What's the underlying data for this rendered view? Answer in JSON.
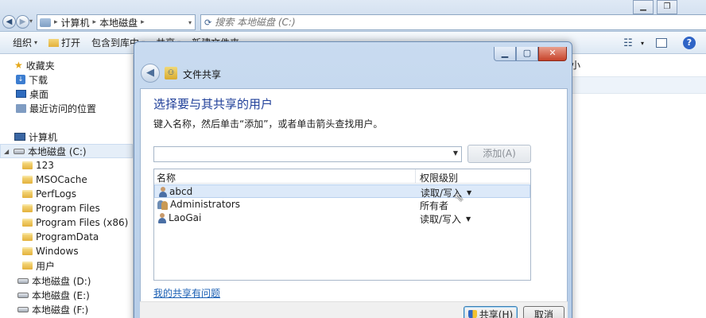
{
  "address": {
    "segments": [
      "计算机",
      "本地磁盘"
    ]
  },
  "search": {
    "placeholder": "搜索 本地磁盘 (C:)"
  },
  "toolbar": {
    "organize": "组织",
    "open": "打开",
    "include_in_library": "包含到库中",
    "share": "共享",
    "new_folder": "新建文件夹"
  },
  "navpane": {
    "favorites": "收藏夹",
    "downloads": "下载",
    "desktop": "桌面",
    "recent": "最近访问的位置",
    "computer": "计算机",
    "drive_c": "本地磁盘 (C:)",
    "folders": [
      "123",
      "MSOCache",
      "PerfLogs",
      "Program Files",
      "Program Files (x86)",
      "ProgramData",
      "Windows",
      "用户"
    ],
    "drive_d": "本地磁盘 (D:)",
    "drive_e": "本地磁盘 (E:)",
    "drive_f": "本地磁盘 (F:)"
  },
  "content": {
    "size_header": "小"
  },
  "dialog": {
    "title": "文件共享",
    "heading": "选择要与其共享的用户",
    "instruction": "键入名称，然后单击“添加”，或者单击箭头查找用户。",
    "add_button": "添加(A)",
    "columns": {
      "name": "名称",
      "permission": "权限级别"
    },
    "rows": [
      {
        "name": "abcd",
        "permission": "读取/写入"
      },
      {
        "name": "Administrators",
        "permission": "所有者"
      },
      {
        "name": "LaoGai",
        "permission": "读取/写入"
      }
    ],
    "help_link": "我的共享有问题",
    "share_button": "共享(H)",
    "cancel_button": "取消"
  }
}
